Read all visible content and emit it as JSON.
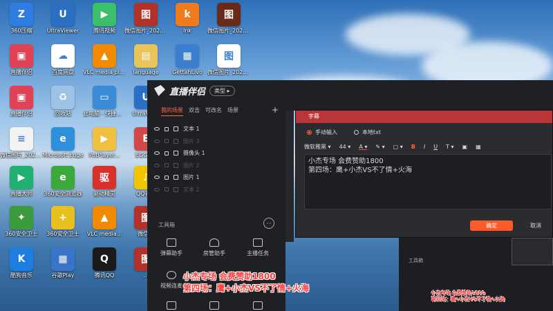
{
  "desktop": {
    "icons": [
      {
        "label": "360压缩",
        "color": "#2f7de0",
        "glyph": "Z"
      },
      {
        "label": "UltraViewer",
        "color": "#2a6fc4",
        "glyph": "U"
      },
      {
        "label": "腾讯视频",
        "color": "#3bbf6a",
        "glyph": "▶"
      },
      {
        "label": "微信图片_2021100...",
        "color": "#b2322a",
        "glyph": "图"
      },
      {
        "label": "Ink",
        "color": "#f07a1e",
        "glyph": "k"
      },
      {
        "label": "微信图片_2022052...",
        "color": "#6a2a1a",
        "glyph": "图"
      },
      {
        "label": "直播伴侣",
        "color": "#e04256",
        "glyph": "▣"
      },
      {
        "label": "百度网盘",
        "color": "#ffffff",
        "glyph": "☁"
      },
      {
        "label": "VLC media player",
        "color": "#f08a00",
        "glyph": "▲"
      },
      {
        "label": "language",
        "color": "#e8c45a",
        "glyph": "▤"
      },
      {
        "label": "GettahLivo",
        "color": "#3c7fd0",
        "glyph": "▦"
      },
      {
        "label": "微信图片_2022041...",
        "color": "#ffffff",
        "glyph": "图"
      },
      {
        "label": "直播伴侣",
        "color": "#e04256",
        "glyph": "▣"
      },
      {
        "label": "回收站",
        "color": "#9cc3e6",
        "glyph": "♻"
      },
      {
        "label": "此电脑 - 快捷方式",
        "color": "#3b8bd6",
        "glyph": "▭"
      },
      {
        "label": "UltraVie...",
        "color": "#2a6fc4",
        "glyph": "U"
      },
      {
        "label": "微信图片_2022041...",
        "color": "#f2f2f2",
        "glyph": "≡"
      },
      {
        "label": "Microsoft Edge",
        "color": "#2e90d8",
        "glyph": "e"
      },
      {
        "label": "PotPlayer...",
        "color": "#f0c040",
        "glyph": "▶"
      },
      {
        "label": "EGGS...",
        "color": "#d04848",
        "glyph": "E"
      },
      {
        "label": "直播大师",
        "color": "#20b070",
        "glyph": "▶"
      },
      {
        "label": "360安全浏览器",
        "color": "#3aa83a",
        "glyph": "e"
      },
      {
        "label": "驱动精灵",
        "color": "#d8302a",
        "glyph": "驱"
      },
      {
        "label": "QQ音...",
        "color": "#f0c400",
        "glyph": "♪"
      },
      {
        "label": "360安全卫士",
        "color": "#3c9b3c",
        "glyph": "✦"
      },
      {
        "label": "360安全卫士",
        "color": "#e8c020",
        "glyph": "+"
      },
      {
        "label": "VLC media...",
        "color": "#f08a00",
        "glyph": "▲"
      },
      {
        "label": "微信...",
        "color": "#b2322a",
        "glyph": "图"
      },
      {
        "label": "酷狗音乐",
        "color": "#1b7ee0",
        "glyph": "K"
      },
      {
        "label": "谷歌Play",
        "color": "#3a74c8",
        "glyph": "▦"
      },
      {
        "label": "腾讯QQ",
        "color": "#1a1a1a",
        "glyph": "Q"
      },
      {
        "label": "...",
        "color": "#b2322a",
        "glyph": "图"
      }
    ]
  },
  "app": {
    "name": "直播伴侣",
    "type_button": "类型",
    "scene_tabs": [
      "我的场景",
      "双击",
      "可改名",
      "场景"
    ],
    "add_button": "+",
    "sources": [
      {
        "label": "文本 1",
        "active": true
      },
      {
        "label": "图片 3",
        "active": false
      },
      {
        "label": "摄像头 1",
        "active": true
      },
      {
        "label": "图片 2",
        "active": false
      },
      {
        "label": "图片 1",
        "active": true
      },
      {
        "label": "文本 2",
        "active": false
      }
    ],
    "tools_heading": "工具箱",
    "more": "···",
    "tools": [
      "弹幕助手",
      "房管助手",
      "主播任务",
      "视频连麦"
    ]
  },
  "modal": {
    "title": "字幕",
    "radio_manual": "手动输入",
    "radio_local": "本地txt",
    "font_family": "微软雅黑",
    "font_size": "44",
    "text_line1": "小杰专场 会费赞助1800",
    "text_line2": "第四场：鹰+小杰VS不了情+火海",
    "confirm": "确定",
    "cancel": "取消"
  },
  "overlay": {
    "line1": "小杰专场 会费赞助1800",
    "line2": "第四场：鹰+小杰VS不了情+火海",
    "accent": "#ff3b3b"
  },
  "preview": {
    "tools_heading": "工具箱",
    "line1": "小杰专场 会费赞助1800",
    "line2": "第四场：鹰+小杰VS不了情+火海"
  }
}
